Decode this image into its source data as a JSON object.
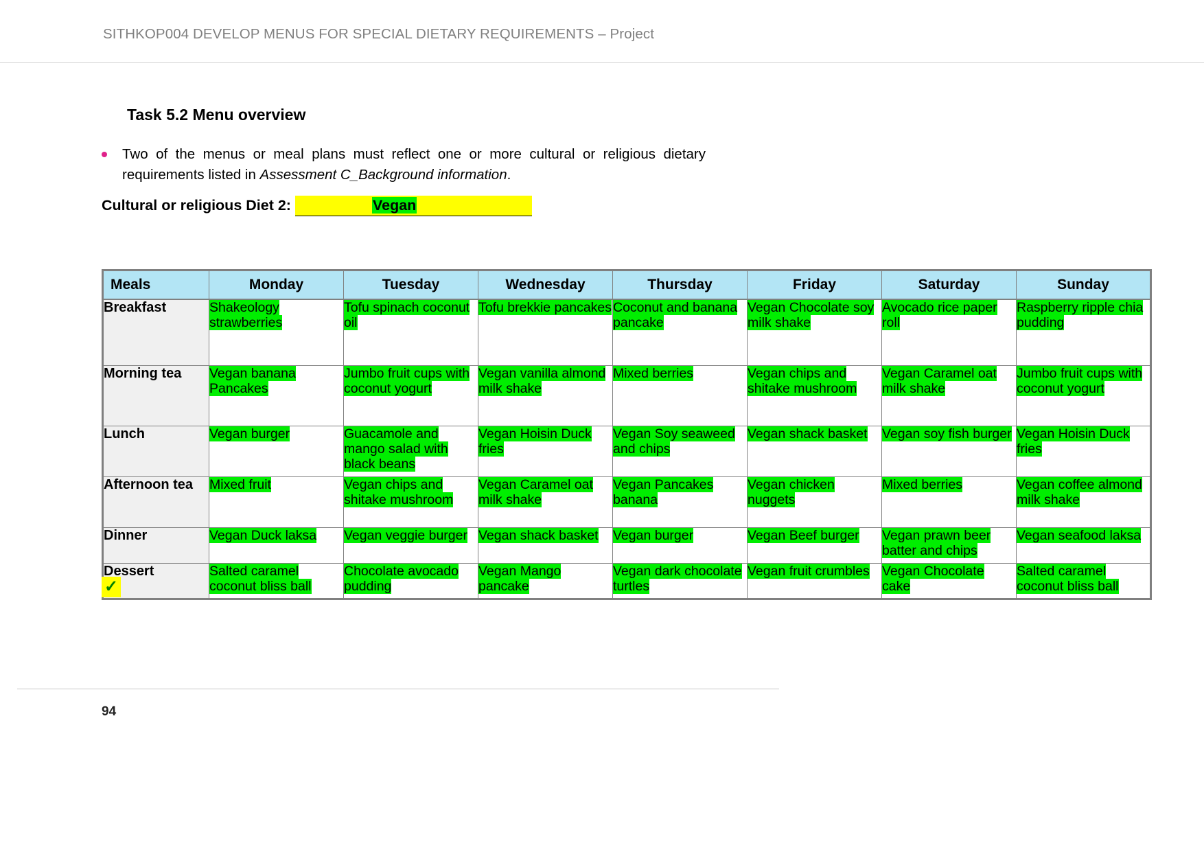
{
  "header": {
    "title": "SITHKOP004 DEVELOP MENUS FOR SPECIAL DIETARY REQUIREMENTS – Project"
  },
  "task": {
    "title": "Task 5.2 Menu overview",
    "bullet_part1": "Two of the menus or meal plans must reflect one or more cultural or religious dietary requirements listed in ",
    "bullet_italic": "Assessment C_Background information",
    "bullet_part2": "."
  },
  "diet": {
    "label": "Cultural or religious Diet 2:",
    "value": "Vegan"
  },
  "table": {
    "columns": [
      "Meals",
      "Monday",
      "Tuesday",
      "Wednesday",
      "Thursday",
      "Friday",
      "Saturday",
      "Sunday"
    ],
    "rows": [
      {
        "meal": "Breakfast",
        "cells": [
          "Shakeology strawberries",
          "Tofu spinach coconut oil",
          "Tofu brekkie pancakes",
          "Coconut and banana pancake",
          "Vegan Chocolate soy milk shake",
          "Avocado rice paper roll",
          "Raspberry ripple chia pudding"
        ]
      },
      {
        "meal": "Morning tea",
        "cells": [
          "Vegan banana Pancakes",
          "Jumbo fruit cups with coconut yogurt",
          "Vegan vanilla almond milk shake",
          "Mixed berries",
          "Vegan chips and shitake mushroom",
          "Vegan Caramel oat milk shake",
          "Jumbo fruit cups with coconut yogurt"
        ]
      },
      {
        "meal": "Lunch",
        "cells": [
          "Vegan burger",
          "Guacamole and mango salad with black beans",
          "Vegan Hoisin Duck fries",
          "Vegan Soy seaweed and chips",
          "Vegan shack basket",
          "Vegan soy fish burger",
          "Vegan Hoisin Duck fries"
        ]
      },
      {
        "meal": "Afternoon tea",
        "cells": [
          "Mixed fruit",
          "Vegan chips and shitake mushroom",
          "Vegan Caramel oat milk shake",
          "Vegan Pancakes banana",
          "Vegan chicken nuggets",
          "Mixed berries",
          "Vegan coffee almond milk shake"
        ]
      },
      {
        "meal": "Dinner",
        "cells": [
          "Vegan Duck laksa",
          "Vegan veggie burger",
          "Vegan shack basket",
          "Vegan burger",
          "Vegan Beef burger",
          "Vegan prawn beer batter and chips",
          "Vegan seafood laksa"
        ]
      },
      {
        "meal": "Dessert",
        "cells": [
          "Salted caramel coconut bliss ball",
          "Chocolate avocado pudding",
          "Vegan Mango pancake",
          "Vegan dark chocolate turtles",
          "Vegan fruit crumbles",
          "Vegan Chocolate cake",
          "Salted caramel coconut bliss ball"
        ]
      }
    ]
  },
  "annotation": {
    "check": "✓"
  },
  "footer": {
    "page_number": "94"
  },
  "colors": {
    "highlight_green": "#00ee00",
    "highlight_yellow": "#ffff00",
    "header_blue": "#b3e5f5",
    "meal_label_gray": "#f0f0f0",
    "bullet_pink": "#e0218a",
    "header_text_gray": "#808080"
  }
}
